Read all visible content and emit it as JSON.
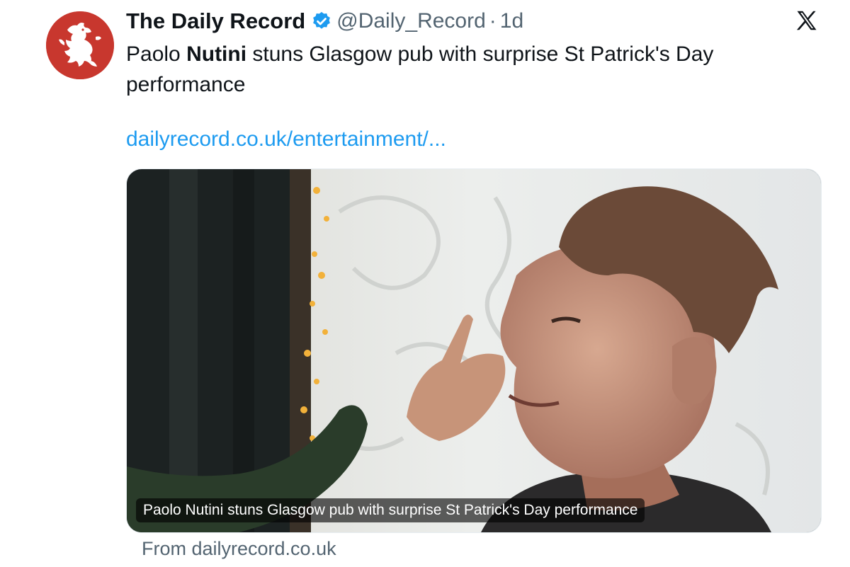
{
  "tweet": {
    "author_name": "The Daily Record",
    "handle": "@Daily_Record",
    "separator": "·",
    "time": "1d",
    "text_before": "Paolo ",
    "text_bold": "Nutini",
    "text_after": " stuns Glasgow pub with surprise St Patrick's Day performance",
    "link": "dailyrecord.co.uk/entertainment/..."
  },
  "card": {
    "caption": "Paolo Nutini stuns Glasgow pub with surprise St Patrick's Day performance",
    "source": "From dailyrecord.co.uk"
  },
  "icons": {
    "verified": "verified-badge-icon",
    "platform": "x-logo-icon",
    "avatar": "daily-record-lion-logo"
  },
  "colors": {
    "verified_blue": "#1d9bf0",
    "link_blue": "#1d9bf0",
    "avatar_red": "#c8372e",
    "muted_text": "#536471"
  }
}
